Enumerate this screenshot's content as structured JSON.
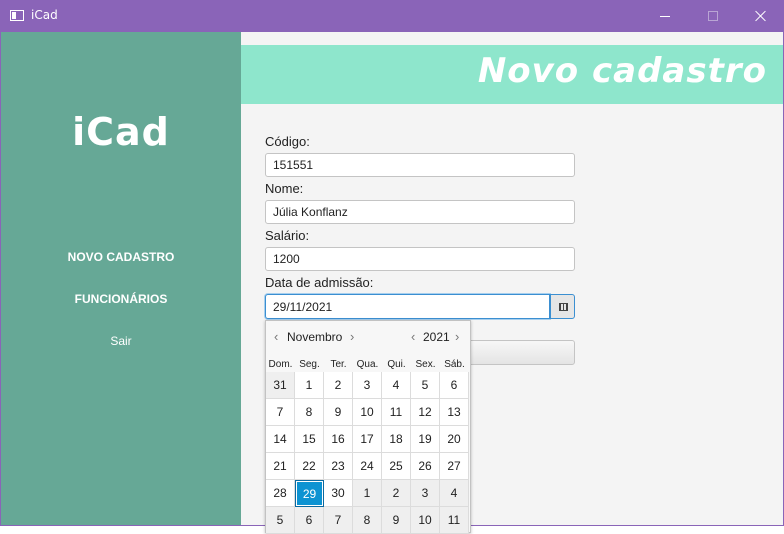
{
  "window": {
    "title": "iCad"
  },
  "sidebar": {
    "logo": "iCad",
    "items": [
      {
        "label": "NOVO CADASTRO"
      },
      {
        "label": "FUNCIONÁRIOS"
      },
      {
        "label": "Sair"
      }
    ]
  },
  "header": {
    "title": "Novo cadastro"
  },
  "form": {
    "codigo": {
      "label": "Código:",
      "value": "151551"
    },
    "nome": {
      "label": "Nome:",
      "value": "Júlia Konflanz"
    },
    "salario": {
      "label": "Salário:",
      "value": "1200"
    },
    "data_admissao": {
      "label": "Data de admissão:",
      "value": "29/11/2021"
    }
  },
  "calendar": {
    "month": "Novembro",
    "year": "2021",
    "weekdays": [
      "Dom.",
      "Seg.",
      "Ter.",
      "Qua.",
      "Qui.",
      "Sex.",
      "Sáb."
    ],
    "weeks": [
      [
        "31",
        "1",
        "2",
        "3",
        "4",
        "5",
        "6"
      ],
      [
        "7",
        "8",
        "9",
        "10",
        "11",
        "12",
        "13"
      ],
      [
        "14",
        "15",
        "16",
        "17",
        "18",
        "19",
        "20"
      ],
      [
        "21",
        "22",
        "23",
        "24",
        "25",
        "26",
        "27"
      ],
      [
        "28",
        "29",
        "30",
        "1",
        "2",
        "3",
        "4"
      ],
      [
        "5",
        "6",
        "7",
        "8",
        "9",
        "10",
        "11"
      ]
    ],
    "selected_day": "29",
    "colors": {
      "selected": "#0d93d2",
      "sidebar": "#66a896",
      "header": "#8ee6cc",
      "titlebar": "#8a64b8"
    }
  }
}
